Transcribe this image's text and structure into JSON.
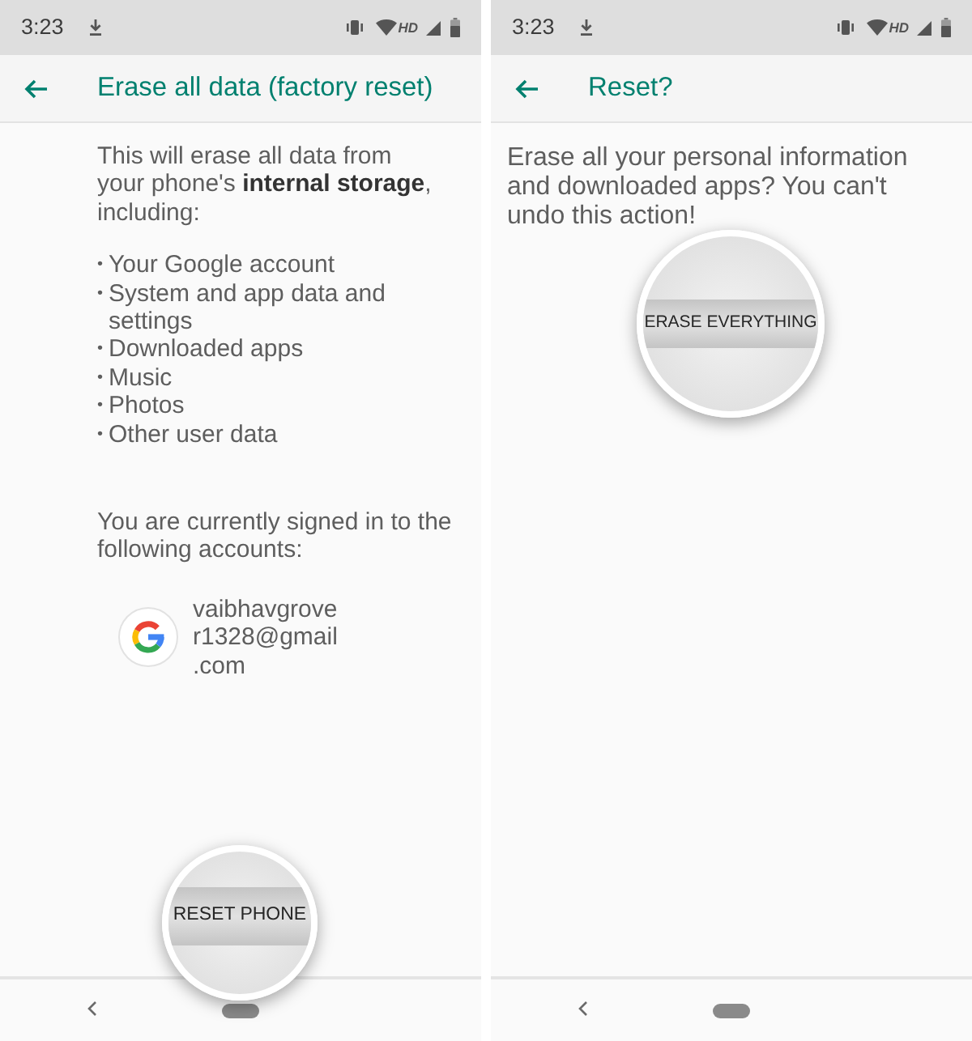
{
  "screens": [
    {
      "status_bar": {
        "time": "3:23",
        "network_label": "HD"
      },
      "app_bar": {
        "title": "Erase all data (factory reset)"
      },
      "body": {
        "kind": "erase_info",
        "intro": "This will erase all data from your phone's **internal storage**, including:",
        "items": [
          {
            "bullet": "•",
            "text": "Your Google account"
          },
          {
            "bullet": "•",
            "text": "System and app data and settings"
          },
          {
            "bullet": "•",
            "text": "Downloaded apps"
          },
          {
            "bullet": "•",
            "text": "Music"
          },
          {
            "bullet": "•",
            "text": "Photos"
          },
          {
            "bullet": "•",
            "text": "Other user data"
          }
        ],
        "accounts_note": "You are currently signed in to the following accounts:",
        "accounts": [
          {
            "email": "vaibhavgrover1328@gmail.com"
          }
        ]
      },
      "magnified_button": {
        "label": "RESET PHONE"
      }
    },
    {
      "status_bar": {
        "time": "3:23",
        "network_label": "HD"
      },
      "app_bar": {
        "title": "Reset?"
      },
      "body": {
        "kind": "confirm",
        "message": "Erase all your personal information and downloaded apps? You can't undo this action!"
      },
      "magnified_button": {
        "label": "ERASE EVERYTHING"
      }
    }
  ]
}
